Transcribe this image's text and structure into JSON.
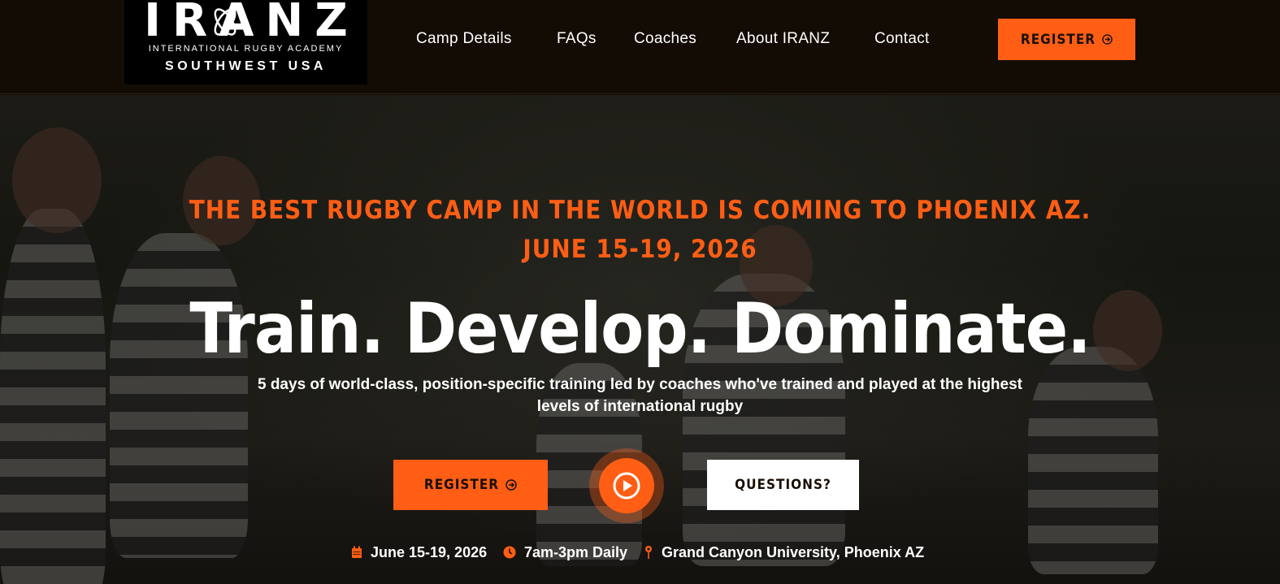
{
  "header": {
    "logo": {
      "wordmark": "IRANZ",
      "subtitle": "INTERNATIONAL RUGBY ACADEMY",
      "region": "SOUTHWEST USA"
    },
    "nav": [
      "Camp Details",
      "FAQs",
      "Coaches",
      "About IRANZ",
      "Contact"
    ],
    "register_label": "REGISTER"
  },
  "hero": {
    "kicker_line1": "THE BEST RUGBY CAMP IN THE WORLD IS COMING TO PHOENIX AZ.",
    "kicker_line2": "JUNE 15-19, 2026",
    "headline": "Train. Develop. Dominate.",
    "subtext": "5 days of world-class, position-specific training led by coaches who've trained and played at the highest levels of international rugby",
    "register_label": "REGISTER",
    "questions_label": "QUESTIONS?",
    "details": {
      "date": "June 15-19, 2026",
      "time": "7am-3pm Daily",
      "location": "Grand Canyon University, Phoenix AZ"
    }
  },
  "colors": {
    "accent": "#ff5e14",
    "header_bg": "#130c04",
    "text": "#ffffff"
  },
  "icons": [
    "calendar-icon",
    "clock-icon",
    "map-pin-icon",
    "play-icon",
    "arrow-circle-icon"
  ]
}
